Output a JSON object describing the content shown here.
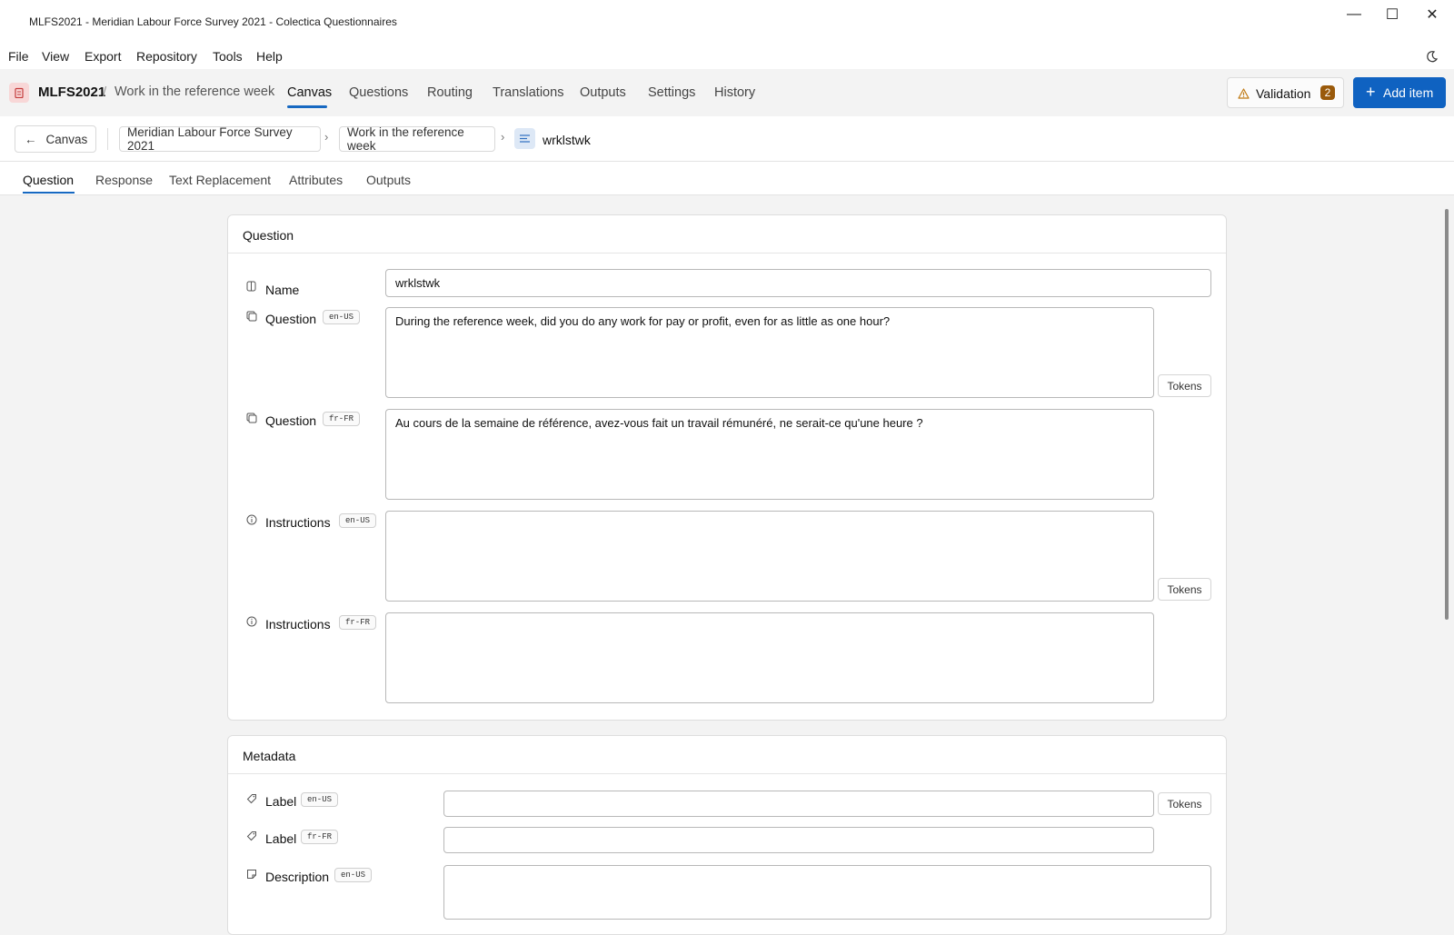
{
  "window": {
    "title": "MLFS2021 - Meridian Labour Force Survey 2021 - Colectica Questionnaires",
    "controls": {
      "minimize": "—",
      "maximize": "☐",
      "close": "✕"
    }
  },
  "menu": [
    "File",
    "View",
    "Export",
    "Repository",
    "Tools",
    "Help"
  ],
  "nav": {
    "project": "MLFS2021",
    "separator": "/",
    "current": "Work in the reference week",
    "links": [
      "Canvas",
      "Questions",
      "Routing",
      "Translations",
      "Outputs",
      "Settings",
      "History"
    ],
    "active": "Canvas",
    "validation_label": "Validation",
    "validation_count": "2",
    "add_label": "Add item"
  },
  "breadcrumb": {
    "back_label": "Canvas",
    "items": [
      "Meridian Labour Force Survey 2021",
      "Work in the reference week"
    ],
    "current": "wrklstwk"
  },
  "tabs": [
    "Question",
    "Response",
    "Text Replacement",
    "Attributes",
    "Outputs"
  ],
  "active_tab": "Question",
  "question_card": {
    "title": "Question",
    "name_label": "Name",
    "name_value": "wrklstwk",
    "fields": [
      {
        "label": "Question",
        "lang": "en-US",
        "value": "During the reference week, did you do any work for pay or profit, even for as little as one hour?",
        "tokens": "Tokens"
      },
      {
        "label": "Question",
        "lang": "fr-FR",
        "value": "Au cours de la semaine de référence, avez-vous fait un travail rémunéré, ne serait-ce qu'une heure ?"
      },
      {
        "label": "Instructions",
        "lang": "en-US",
        "value": "",
        "tokens": "Tokens"
      },
      {
        "label": "Instructions",
        "lang": "fr-FR",
        "value": ""
      }
    ]
  },
  "metadata_card": {
    "title": "Metadata",
    "fields": [
      {
        "label": "Label",
        "lang": "en-US",
        "value": "",
        "tokens": "Tokens"
      },
      {
        "label": "Label",
        "lang": "fr-FR",
        "value": ""
      },
      {
        "label": "Description",
        "lang": "en-US",
        "value": ""
      }
    ]
  }
}
